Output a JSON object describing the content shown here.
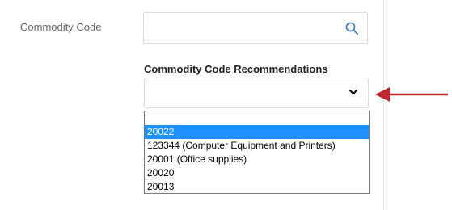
{
  "commodity_code": {
    "label": "Commodity Code",
    "value": "",
    "placeholder": ""
  },
  "recommendations": {
    "title": "Commodity Code Recommendations",
    "selected_value": "",
    "options": [
      "20022",
      "123344 (Computer Equipment and Printers)",
      "20001 (Office supplies)",
      "20020",
      "20013"
    ],
    "highlighted_option": "20022"
  },
  "icons": {
    "search": "search-icon",
    "chevron": "chevron-down-icon",
    "arrow": "arrow-left-icon"
  },
  "colors": {
    "highlight": "#1e90ff",
    "annotation_arrow": "#c0282d",
    "search_icon": "#3a78c9"
  }
}
